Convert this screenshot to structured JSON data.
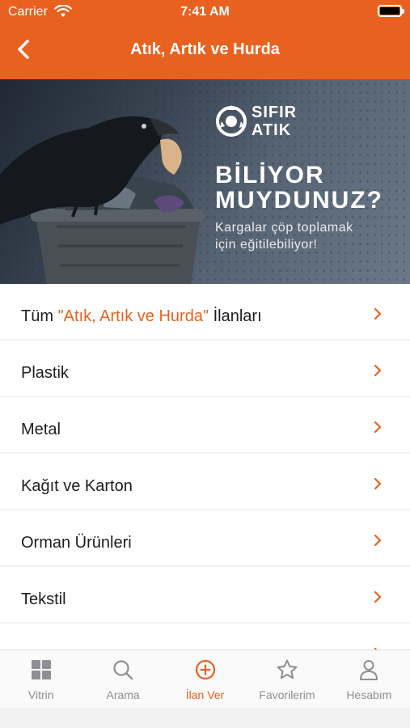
{
  "status": {
    "carrier": "Carrier",
    "time": "7:41 AM"
  },
  "nav": {
    "title": "Atık, Artık ve Hurda"
  },
  "banner": {
    "logo_line1": "SIFIR",
    "logo_line2": "ATIK",
    "headline_line1": "BİLİYOR",
    "headline_line2": "MUYDUNUZ?",
    "sub_line1": "Kargalar çöp toplamak",
    "sub_line2": "için eğitilebiliyor!"
  },
  "list": {
    "all_prefix": "Tüm ",
    "all_accent": "\"Atık, Artık ve Hurda\"",
    "all_suffix": " İlanları",
    "items": [
      "Plastik",
      "Metal",
      "Kağıt ve Karton",
      "Orman Ürünleri",
      "Tekstil"
    ]
  },
  "tabs": [
    {
      "label": "Vitrin",
      "icon": "grid-icon"
    },
    {
      "label": "Arama",
      "icon": "search-icon"
    },
    {
      "label": "İlan Ver",
      "icon": "plus-circle-icon"
    },
    {
      "label": "Favorilerim",
      "icon": "star-icon"
    },
    {
      "label": "Hesabım",
      "icon": "person-icon"
    }
  ],
  "colors": {
    "accent": "#e8611f",
    "text": "#1d1d1f",
    "tab_inactive": "#8e8e93"
  }
}
